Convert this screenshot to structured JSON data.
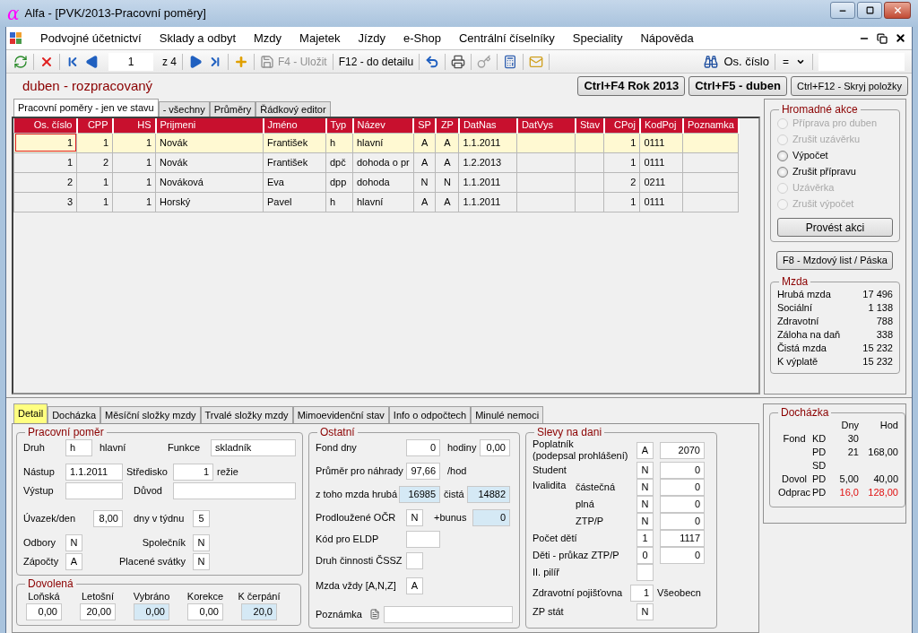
{
  "window": {
    "logo": "α",
    "title": "Alfa - [PVK/2013-Pracovní poměry]"
  },
  "menu": [
    "Podvojné účetnictví",
    "Sklady a odbyt",
    "Mzdy",
    "Majetek",
    "Jízdy",
    "e-Shop",
    "Centrální číselníky",
    "Speciality",
    "Nápověda"
  ],
  "toolbar": {
    "record": "1",
    "of": "z 4",
    "save": {
      "label": "F4 - Uložit",
      "disabled": true
    },
    "detail": "F12 - do detailu",
    "search_label": "Os. číslo",
    "operator": "="
  },
  "status": "duben - rozpracovaný",
  "action_buttons": [
    {
      "label": "Ctrl+F4 Rok 2013",
      "bold": true
    },
    {
      "label": "Ctrl+F5 - duben",
      "bold": true
    },
    {
      "label": "Ctrl+F12 - Skryj položky",
      "bold": false
    }
  ],
  "list_tabs": [
    {
      "label": "Pracovní poměry - jen ve stavu",
      "selected": true
    },
    {
      "label": "- všechny",
      "selected": false
    },
    {
      "label": "Průměry",
      "selected": false
    },
    {
      "label": "Řádkový editor",
      "selected": false
    }
  ],
  "table": {
    "columns": [
      "Os. číslo",
      "CPP",
      "HS",
      "Prijmeni",
      "Jméno",
      "Typ",
      "Název",
      "SP",
      "ZP",
      "DatNas",
      "DatVys",
      "Stav",
      "CPoj",
      "KodPoj",
      "Poznamka"
    ],
    "rows": [
      {
        "selected": true,
        "cells": [
          "1",
          "1",
          "1",
          "Novák",
          "František",
          "h",
          "hlavní",
          "A",
          "A",
          "1.1.2011",
          "",
          "",
          "1",
          "0111",
          ""
        ]
      },
      {
        "selected": false,
        "cells": [
          "1",
          "2",
          "1",
          "Novák",
          "František",
          "dpč",
          "dohoda o pr",
          "A",
          "A",
          "1.2.2013",
          "",
          "",
          "1",
          "0111",
          ""
        ]
      },
      {
        "selected": false,
        "cells": [
          "2",
          "1",
          "1",
          "Nováková",
          "Eva",
          "dpp",
          "dohoda",
          "N",
          "N",
          "1.1.2011",
          "",
          "",
          "2",
          "0211",
          ""
        ]
      },
      {
        "selected": false,
        "cells": [
          "3",
          "1",
          "1",
          "Horský",
          "Pavel",
          "h",
          "hlavní",
          "A",
          "A",
          "1.1.2011",
          "",
          "",
          "1",
          "0111",
          ""
        ]
      }
    ]
  },
  "bulk_actions": {
    "title": "Hromadné akce",
    "options": [
      {
        "label": "Příprava pro duben",
        "disabled": true,
        "selected": false
      },
      {
        "label": "Zrušit uzávěrku",
        "disabled": true,
        "selected": false
      },
      {
        "label": "Výpočet",
        "disabled": false,
        "selected": false
      },
      {
        "label": "Zrušit přípravu",
        "disabled": false,
        "selected": false
      },
      {
        "label": "Uzávěrka",
        "disabled": true,
        "selected": false
      },
      {
        "label": "Zrušit výpočet",
        "disabled": true,
        "selected": false
      }
    ],
    "button": "Provést akci"
  },
  "payslip_button": "F8 - Mzdový list / Páska",
  "wage": {
    "title": "Mzda",
    "rows": [
      {
        "label": "Hrubá mzda",
        "value": "17 496"
      },
      {
        "label": "Sociální",
        "value": "1 138"
      },
      {
        "label": "Zdravotní",
        "value": "788"
      },
      {
        "label": "Záloha na daň",
        "value": "338"
      },
      {
        "label": "Čistá mzda",
        "value": "15 232"
      },
      {
        "label": "K výplatě",
        "value": "15 232"
      }
    ]
  },
  "detail_tabs": [
    {
      "label": "Detail",
      "selected": true
    },
    {
      "label": "Docházka",
      "selected": false
    },
    {
      "label": "Měsíční složky mzdy",
      "selected": false
    },
    {
      "label": "Trvalé složky mzdy",
      "selected": false
    },
    {
      "label": "Mimoevidenční stav",
      "selected": false
    },
    {
      "label": "Info o odpočtech",
      "selected": false
    },
    {
      "label": "Minulé nemoci",
      "selected": false
    }
  ],
  "employment": {
    "title": "Pracovní poměr",
    "rows": [
      [
        {
          "kind": "label",
          "text": "Druh"
        },
        {
          "kind": "field",
          "value": "h",
          "readonly": false
        },
        {
          "kind": "label",
          "text": "hlavní"
        },
        {
          "kind": "label",
          "text": "Funkce"
        },
        {
          "kind": "field",
          "value": "skladník",
          "readonly": false
        }
      ],
      [
        {
          "kind": "label",
          "text": "Nástup"
        },
        {
          "kind": "field",
          "value": "1.1.2011",
          "readonly": false
        },
        {
          "kind": "label",
          "text": "Středisko"
        },
        {
          "kind": "field",
          "value": "1",
          "readonly": false
        },
        {
          "kind": "label",
          "text": "režie"
        }
      ],
      [
        {
          "kind": "label",
          "text": "Výstup"
        },
        {
          "kind": "field",
          "readonly": false
        },
        {
          "kind": "label",
          "text": "Důvod"
        },
        {
          "kind": "field",
          "readonly": false
        }
      ],
      [
        {
          "kind": "label",
          "text": "Úvazek/den"
        },
        {
          "kind": "field",
          "value": "8,00",
          "readonly": false
        },
        {
          "kind": "label",
          "text": "dny v týdnu"
        },
        {
          "kind": "field",
          "value": "5",
          "readonly": false
        }
      ],
      [
        {
          "kind": "label",
          "text": "Odbory"
        },
        {
          "kind": "field",
          "value": "N",
          "readonly": false
        },
        {
          "kind": "label",
          "text": "Společník"
        },
        {
          "kind": "field",
          "value": "N",
          "readonly": false
        }
      ],
      [
        {
          "kind": "label",
          "text": "Zápočty"
        },
        {
          "kind": "field",
          "value": "A",
          "readonly": false
        },
        {
          "kind": "label",
          "text": "Placené svátky"
        },
        {
          "kind": "field",
          "value": "N",
          "readonly": false
        }
      ]
    ]
  },
  "vacation": {
    "title": "Dovolená",
    "items": [
      {
        "label": "Loňská",
        "value": "0,00",
        "readonly": false
      },
      {
        "label": "Letošní",
        "value": "20,00",
        "readonly": false
      },
      {
        "label": "Vybráno",
        "value": "0,00",
        "readonly": true
      },
      {
        "label": "Korekce",
        "value": "0,00",
        "readonly": false
      },
      {
        "label": "K čerpání",
        "value": "20,0",
        "readonly": true
      }
    ]
  },
  "other": {
    "title": "Ostatní",
    "rows": [
      [
        {
          "kind": "label",
          "text": "Fond dny"
        },
        {
          "kind": "field",
          "value": "0",
          "readonly": false
        },
        {
          "kind": "label",
          "text": "hodiny"
        },
        {
          "kind": "field",
          "value": "0,00",
          "readonly": false
        }
      ],
      [
        {
          "kind": "label",
          "text": "Průměr pro náhrady"
        },
        {
          "kind": "field",
          "value": "97,66",
          "readonly": false
        },
        {
          "kind": "label",
          "text": "/hod"
        }
      ],
      [
        {
          "kind": "label",
          "text": "z toho mzda hrubá"
        },
        {
          "kind": "field",
          "value": "16985",
          "readonly": true
        },
        {
          "kind": "label",
          "text": "čistá"
        },
        {
          "kind": "field",
          "value": "14882",
          "readonly": true
        }
      ],
      [
        {
          "kind": "label",
          "text": "Prodloužené OČR"
        },
        {
          "kind": "field",
          "value": "N",
          "readonly": false
        },
        {
          "kind": "label",
          "text": "+bunus"
        },
        {
          "kind": "field",
          "value": "0",
          "readonly": true
        }
      ],
      [
        {
          "kind": "label",
          "text": "Kód pro ELDP"
        },
        {
          "kind": "field",
          "readonly": false
        }
      ],
      [
        {
          "kind": "label",
          "text": "Druh činnosti ČSSZ"
        },
        {
          "kind": "field",
          "readonly": false
        }
      ],
      [
        {
          "kind": "label",
          "text": "Mzda vždy [A,N,Z]"
        },
        {
          "kind": "field",
          "value": "A",
          "readonly": false
        }
      ],
      [
        {
          "kind": "label",
          "text": "Poznámka"
        },
        {
          "kind": "memo",
          "readonly": false
        }
      ]
    ]
  },
  "tax_relief": {
    "title": "Slevy na dani",
    "rows": [
      {
        "label": "Poplatník",
        "label_note": "(podepsal prohlášení)",
        "flag": "A",
        "amount": "2070"
      },
      {
        "label": "Student",
        "flag": "N",
        "amount": "0"
      },
      {
        "label": "Ivalidita",
        "sublabel": "částečná",
        "flag": "N",
        "amount": "0"
      },
      {
        "sublabel": "plná",
        "flag": "N",
        "amount": "0"
      },
      {
        "sublabel": "ZTP/P",
        "flag": "N",
        "amount": "0"
      },
      {
        "label": "Počet dětí",
        "flag": "1",
        "amount": "1117"
      },
      {
        "label": "Děti - průkaz ZTP/P",
        "flag": "0",
        "amount": "0"
      },
      {
        "label": "II. pilíř"
      },
      {
        "label": "Zdravotní pojišťovna",
        "flag": "1",
        "note": "Všeobecn"
      },
      {
        "label": "ZP stát",
        "flag": "N"
      }
    ]
  },
  "attendance": {
    "title": "Docházka",
    "headers": [
      "Dny",
      "Hod"
    ],
    "rows": [
      {
        "label": "Fond",
        "unit": "KD",
        "days": {
          "text": "30",
          "warning": false
        }
      },
      {
        "unit": "PD",
        "days": {
          "text": "21",
          "warning": false
        },
        "hours": {
          "text": "168,00",
          "warning": false
        }
      },
      {
        "unit": "SD"
      },
      {
        "label": "Dovol",
        "unit": "PD",
        "days": {
          "text": "5,00",
          "warning": false
        },
        "hours": {
          "text": "40,00",
          "warning": false
        }
      },
      {
        "label": "Odprac",
        "unit": "PD",
        "days": {
          "text": "16,0",
          "warning": true
        },
        "hours": {
          "text": "128,00",
          "warning": true
        }
      }
    ]
  }
}
